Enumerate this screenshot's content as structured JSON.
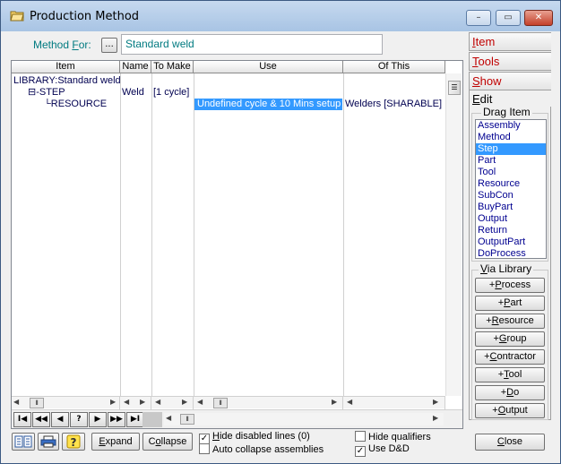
{
  "window": {
    "title": "Production Method",
    "minimize": "–",
    "maximize": "▭",
    "close": "✕"
  },
  "method": {
    "label_pre": "Method ",
    "label_ul": "F",
    "label_post": "or:",
    "picker": "...",
    "value": "Standard weld"
  },
  "grid": {
    "headers": [
      "Item",
      "Name",
      "To Make",
      "Use",
      "Of This"
    ],
    "rows": [
      {
        "item": "LIBRARY:Standard weld",
        "name": "",
        "tomake": "",
        "use": "",
        "ofthis": ""
      },
      {
        "item": "⊟-STEP",
        "name": "Weld",
        "tomake": "[1 cycle]",
        "use": "",
        "ofthis": ""
      },
      {
        "item": "└RESOURCE",
        "name": "",
        "tomake": "",
        "use": "Undefined cycle & 10 Mins setup",
        "ofthis": "Welders [SHARABLE]"
      }
    ],
    "scroll_thumb": "☰",
    "hthumb": "⦀"
  },
  "nav": {
    "first": "I◀",
    "prev_page": "◀◀",
    "prev": "◀",
    "help": "?",
    "next": "▶",
    "next_page": "▶▶",
    "last": "▶I"
  },
  "toolbar": {
    "expand_ul": "E",
    "expand_rest": "xpand",
    "collapse_pre": "C",
    "collapse_ul": "o",
    "collapse_rest": "llapse"
  },
  "options": {
    "hide_disabled_ul": "H",
    "hide_disabled_rest": "ide disabled lines (0)",
    "hide_disabled_checked": "✓",
    "auto_collapse": "Auto collapse assemblies",
    "auto_collapse_checked": "",
    "hide_qualifiers": "Hide qualifiers",
    "hide_qualifiers_checked": "",
    "use_dnd": "Use D&D",
    "use_dnd_checked": "✓"
  },
  "side_tabs": [
    {
      "ul": "I",
      "rest": "tem"
    },
    {
      "ul": "T",
      "rest": "ools"
    },
    {
      "ul": "S",
      "rest": "how"
    },
    {
      "ul": "E",
      "rest": "dit"
    }
  ],
  "drag_item": {
    "label": "Drag Item",
    "items": [
      "Assembly",
      "Method",
      "Step",
      "Part",
      "Tool",
      "Resource",
      "SubCon",
      "BuyPart",
      "Output",
      "Return",
      "OutputPart",
      "DoProcess"
    ],
    "selected": "Step"
  },
  "via_library": {
    "label_ul": "V",
    "label_rest": "ia Library",
    "buttons": [
      {
        "pre": "+",
        "ul": "P",
        "rest": "rocess"
      },
      {
        "pre": "+",
        "ul": "P",
        "rest": "art"
      },
      {
        "pre": "+",
        "ul": "R",
        "rest": "esource"
      },
      {
        "pre": "+",
        "ul": "G",
        "rest": "roup"
      },
      {
        "pre": "+",
        "ul": "C",
        "rest": "ontractor"
      },
      {
        "pre": "+",
        "ul": "T",
        "rest": "ool"
      },
      {
        "pre": "+",
        "ul": "D",
        "rest": "o"
      },
      {
        "pre": "+",
        "ul": "O",
        "rest": "utput"
      }
    ]
  },
  "close": {
    "ul": "C",
    "rest": "lose"
  },
  "colors": {
    "accent": "#3399ff",
    "label_teal": "#007a80",
    "tab_red": "#c00000"
  }
}
